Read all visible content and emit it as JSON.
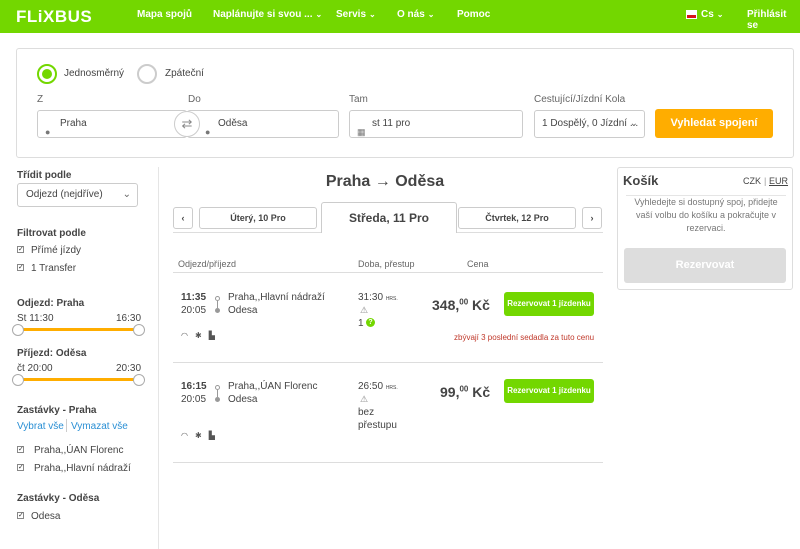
{
  "header": {
    "logo": "FLiXBUS",
    "nav": [
      "Mapa spojů",
      "Naplánujte si svou ...",
      "Servis",
      "O nás",
      "Pomoc"
    ],
    "language": "Cs",
    "login": "Přihlásit se"
  },
  "search": {
    "trip_types": [
      "Jednosměrný",
      "Zpáteční"
    ],
    "selected_trip_type": "Jednosměrný",
    "from_label": "Z",
    "from_value": "Praha",
    "to_label": "Do",
    "to_value": "Oděsa",
    "date_label": "Tam",
    "date_value": "st 11 pro",
    "passengers_label": "Cestující/Jízdní Kola",
    "passengers_value": "1 Dospělý, 0 Jízdní ...",
    "button": "Vyhledat spojení"
  },
  "sidebar": {
    "sort_title": "Třídit podle",
    "sort_value": "Odjezd (nejdříve)",
    "filter_title": "Filtrovat podle",
    "filters": [
      {
        "label": "Přímé jízdy",
        "checked": true
      },
      {
        "label": "1 Transfer",
        "checked": true
      }
    ],
    "departure_title": "Odjezd: Praha",
    "departure_min": "St 11:30",
    "departure_max": "16:30",
    "arrival_title": "Příjezd: Oděsa",
    "arrival_min": "čt 20:00",
    "arrival_max": "20:30",
    "stops_origin_title": "Zastávky - Praha",
    "select_all": "Vybrat vše",
    "clear_all": "Vymazat vše",
    "stops_origin": [
      {
        "label": "Praha,,ÚAN Florenc",
        "checked": true
      },
      {
        "label": "Praha,,Hlavní nádraží",
        "checked": true
      }
    ],
    "stops_dest_title": "Zastávky - Oděsa",
    "stops_dest": [
      {
        "label": "Odesa",
        "checked": true
      }
    ]
  },
  "results": {
    "route_title": "Praha → Oděsa",
    "prev_day": "Úterý, 10 Pro",
    "current_day": "Středa, 11 Pro",
    "next_day": "Čtvrtek, 12 Pro",
    "columns": [
      "Odjezd/příjezd",
      "Doba, přestup",
      "Cena"
    ],
    "rides": [
      {
        "dep_time": "11:35",
        "arr_time": "20:05",
        "dep_stop": "Praha,,Hlavní nádraží",
        "arr_stop": "Odesa",
        "duration": "31:30",
        "duration_suffix": "HRS.",
        "transfer": "1",
        "price_main": "348,",
        "price_cents": "00",
        "currency": "Kč",
        "button": "Rezervovat 1 jízdenku",
        "note": "zbývají 3 poslední sedadla za tuto cenu"
      },
      {
        "dep_time": "16:15",
        "arr_time": "20:05",
        "dep_stop": "Praha,,ÚAN Florenc",
        "arr_stop": "Odesa",
        "duration": "26:50",
        "duration_suffix": "HRS.",
        "transfer": "bez přestupu",
        "price_main": "99,",
        "price_cents": "00",
        "currency": "Kč",
        "button": "Rezervovat 1 jízdenku",
        "note": ""
      }
    ]
  },
  "cart": {
    "title": "Košík",
    "currency_1": "CZK",
    "currency_sep": "|",
    "currency_2": "EUR",
    "message": "Vyhledejte si dostupný spoj, přidejte vaší volbu do košíku a pokračujte v rezervaci.",
    "button": "Rezervovat"
  },
  "colors": {
    "brand": "#73d700",
    "accent": "#ffad00",
    "warning": "#c0392b"
  }
}
